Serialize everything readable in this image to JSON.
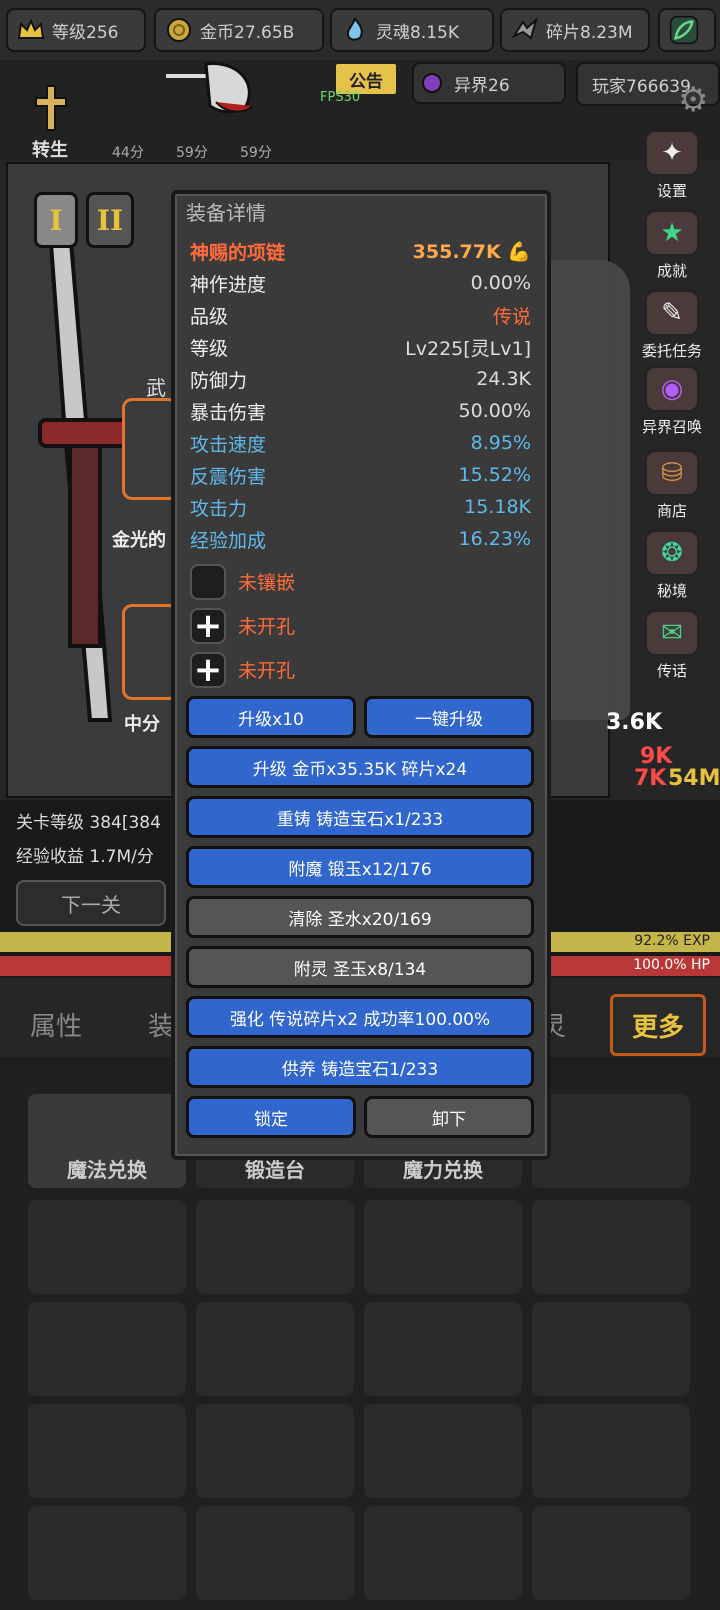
{
  "topbar": {
    "level": "等级256",
    "gold": "金币27.65B",
    "soul": "灵魂8.15K",
    "fragments": "碎片8.23M"
  },
  "header": {
    "notice": "公告",
    "fps": "FPS30",
    "otherworld": "异界26",
    "player": "玩家766639",
    "reborn": "转生",
    "timers": [
      "44分",
      "59分",
      "59分"
    ]
  },
  "scene": {
    "tab_i": "I",
    "tab_ii": "II",
    "weapon_char": "武",
    "slot1_label": "金光的",
    "slot2_label": "中分",
    "stage": "关卡等级 384[384",
    "exp_rate": "经验收益 1.7M/分",
    "next_stage": "下一关",
    "exp_pct": "92.2% EXP",
    "hp_pct": "100.0%   HP",
    "damage_numbers": [
      "3.6K",
      "9K",
      "7K",
      "54M"
    ]
  },
  "side_menu": [
    {
      "label": "设置",
      "icon": "settings-icon"
    },
    {
      "label": "成就",
      "icon": "achievement-icon"
    },
    {
      "label": "委托任务",
      "icon": "quest-icon"
    },
    {
      "label": "异界召唤",
      "icon": "summon-icon"
    },
    {
      "label": "商店",
      "icon": "shop-icon"
    },
    {
      "label": "秘境",
      "icon": "secret-realm-icon"
    },
    {
      "label": "传话",
      "icon": "message-icon"
    }
  ],
  "bottom_tabs": {
    "attributes": "属性",
    "equip": "装",
    "spirit": "灵",
    "more": "更多"
  },
  "grid": {
    "magic_exchange": "魔法兑换",
    "forge": "锻造台",
    "magic_power_exchange": "魔力兑换"
  },
  "dialog": {
    "title": "装备详情",
    "item_name": "神赐的项链",
    "item_power": "355.77K",
    "stats": [
      {
        "key": "神作进度",
        "value": "0.00%",
        "style": "normal"
      },
      {
        "key": "品级",
        "value": "传说",
        "style": "rare"
      },
      {
        "key": "等级",
        "value": "Lv225[灵Lv1]",
        "style": "normal"
      },
      {
        "key": "防御力",
        "value": "24.3K",
        "style": "normal"
      },
      {
        "key": "暴击伤害",
        "value": "50.00%",
        "style": "normal"
      },
      {
        "key": "攻击速度",
        "value": "8.95%",
        "style": "blue"
      },
      {
        "key": "反震伤害",
        "value": "15.52%",
        "style": "blue"
      },
      {
        "key": "攻击力",
        "value": "15.18K",
        "style": "blue"
      },
      {
        "key": "经验加成",
        "value": "16.23%",
        "style": "blue"
      }
    ],
    "sockets": [
      {
        "label": "未镶嵌",
        "icon": ""
      },
      {
        "label": "未开孔",
        "icon": "+"
      },
      {
        "label": "未开孔",
        "icon": "+"
      }
    ],
    "buttons": {
      "upgrade10": "升级x10",
      "one_click": "一键升级",
      "upgrade": "升级 金币x35.35K 碎片x24",
      "recast": "重铸 铸造宝石x1/233",
      "enchant": "附魔 锻玉x12/176",
      "clear": "清除 圣水x20/169",
      "spirit": "附灵 圣玉x8/134",
      "strengthen": "强化 传说碎片x2 成功率100.00%",
      "offering": "供养 铸造宝石1/233",
      "lock": "锁定",
      "unequip": "卸下"
    }
  },
  "colors": {
    "accent_blue": "#3167cc",
    "legend_orange": "#ff6b3a",
    "stat_blue": "#5fb8e8",
    "gold": "#e7c23f"
  }
}
